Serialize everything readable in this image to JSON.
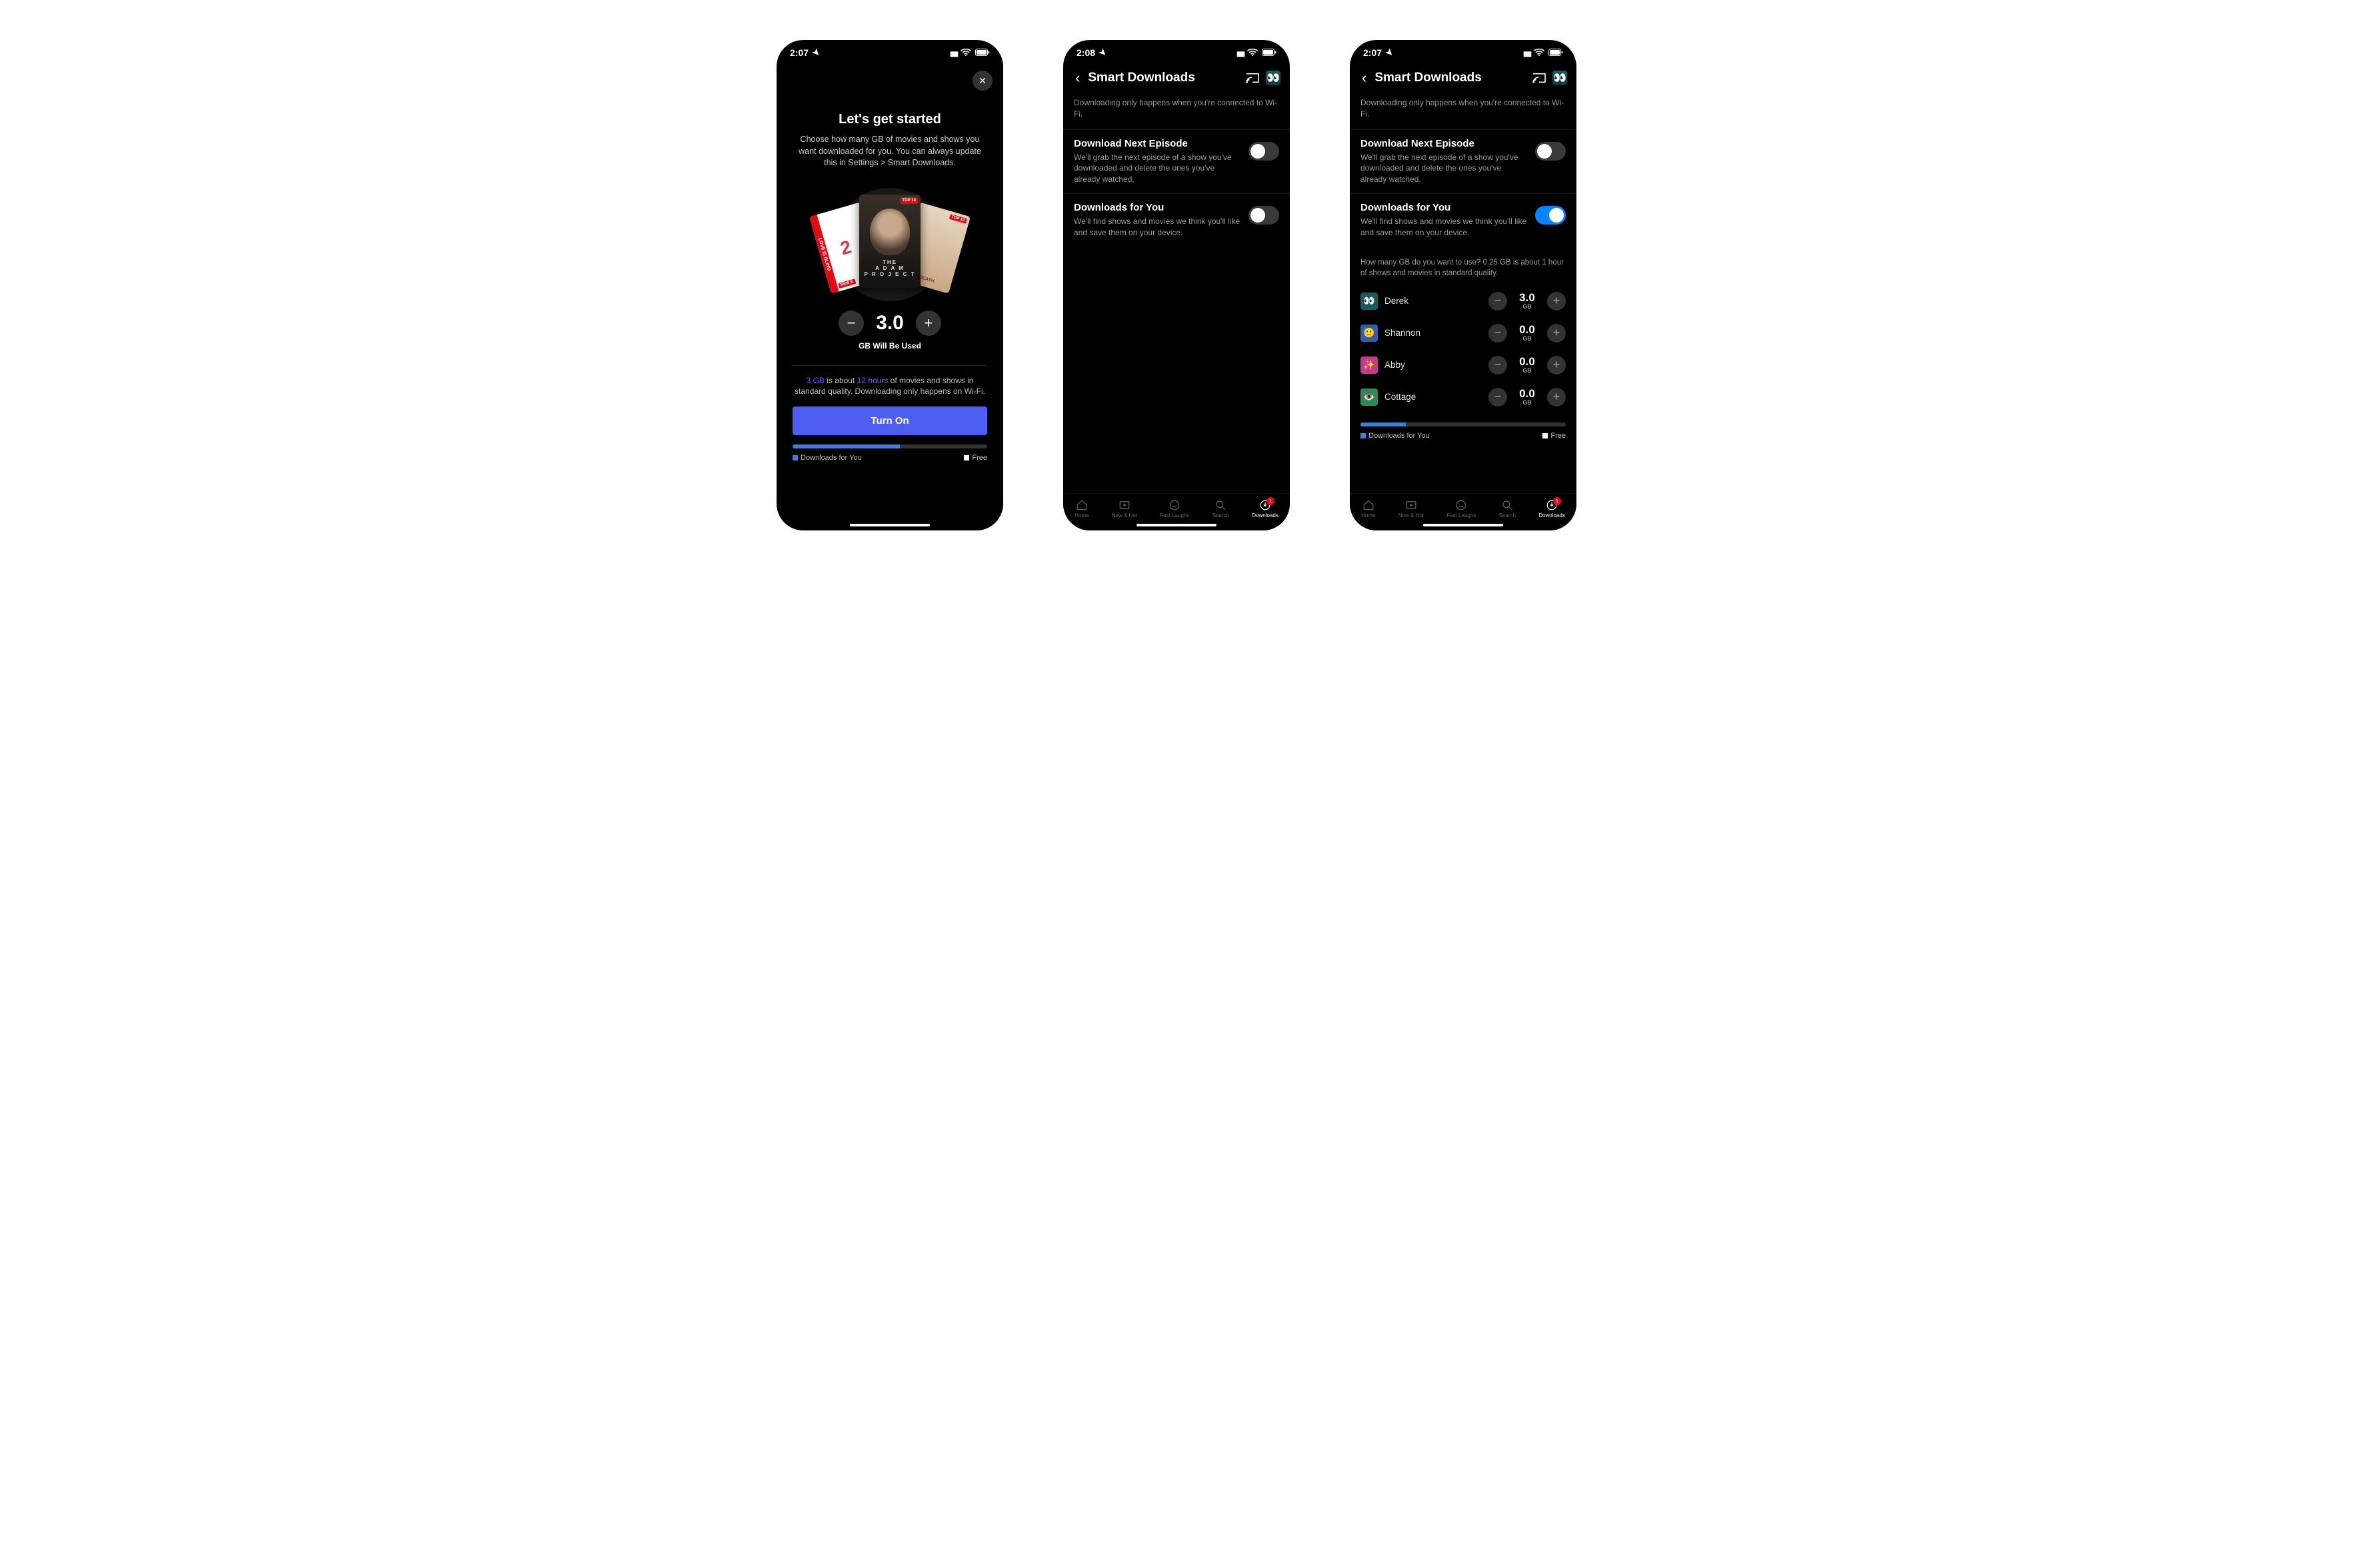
{
  "phone1": {
    "status": {
      "time": "2:07"
    },
    "title": "Let's get started",
    "subtitle": "Choose how many GB of movies and shows you want downloaded for you. You can always update this in Settings > Smart Downloads.",
    "posters": {
      "left_label": "LOVE IS BLIND",
      "left_number": "2",
      "left_new": "NEW E",
      "mid_top10": "TOP 10",
      "mid_line1": "THE",
      "mid_line2": "A D A M",
      "mid_line3": "P R O J E C T",
      "right_top10": "TOP 10",
      "right_label": "RDEATH"
    },
    "stepper_value": "3.0",
    "gb_label": "GB Will Be Used",
    "info_gb": "3 GB",
    "info_mid": " is about ",
    "info_hours": "12 hours",
    "info_rest": " of movies and shows in standard quality. Downloading only happens on Wi-Fi.",
    "cta": "Turn On",
    "bar_pct": 55,
    "legend_dl": "Downloads for You",
    "legend_free": "Free"
  },
  "phone2": {
    "status": {
      "time": "2:08"
    },
    "nav_title": "Smart Downloads",
    "hint": "Downloading only happens when you're connected to Wi-Fi.",
    "s1_title": "Download Next Episode",
    "s1_sub": "We'll grab the next episode of a show you've downloaded and delete the ones you've already watched.",
    "s1_on": false,
    "s2_title": "Downloads for You",
    "s2_sub": "We'll find shows and movies we think you'll like and save them on your device.",
    "s2_on": false
  },
  "phone3": {
    "status": {
      "time": "2:07"
    },
    "nav_title": "Smart Downloads",
    "hint": "Downloading only happens when you're connected to Wi-Fi.",
    "s1_title": "Download Next Episode",
    "s1_sub": "We'll grab the next episode of a show you've downloaded and delete the ones you've already watched.",
    "s1_on": false,
    "s2_title": "Downloads for You",
    "s2_sub": "We'll find shows and movies we think you'll like and save them on your device.",
    "s2_on": true,
    "subhint": "How many GB do you want to use? 0.25 GB is about 1 hour of shows and movies in standard quality.",
    "profiles": [
      {
        "name": "Derek",
        "value": "3.0",
        "color": "#1a5c5e",
        "emoji": "👀"
      },
      {
        "name": "Shannon",
        "value": "0.0",
        "color": "#2f5fb5",
        "emoji": "🙂"
      },
      {
        "name": "Abby",
        "value": "0.0",
        "color": "#c73a8a",
        "emoji": "✨"
      },
      {
        "name": "Cottage",
        "value": "0.0",
        "color": "#2e8b57",
        "emoji": "👁️"
      }
    ],
    "gb_unit": "GB",
    "bar_pct": 22,
    "legend_dl": "Downloads for You",
    "legend_free": "Free"
  },
  "tabs": [
    {
      "label": "Home"
    },
    {
      "label": "New & Hot"
    },
    {
      "label": "Fast Laughs"
    },
    {
      "label": "Search"
    },
    {
      "label": "Downloads",
      "active": true,
      "badge": "1"
    }
  ]
}
